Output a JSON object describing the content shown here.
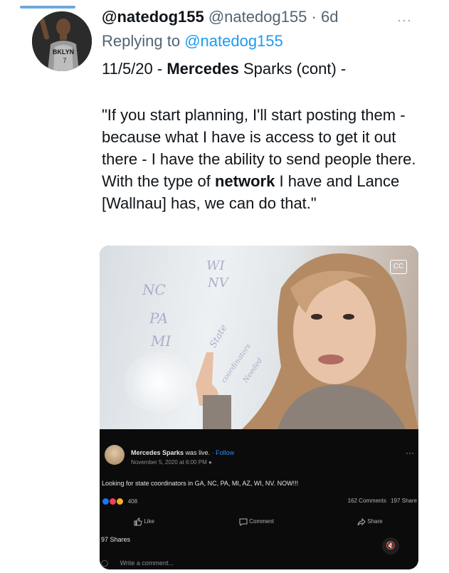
{
  "tweet": {
    "display_name": "@natedog155",
    "handle": "@natedog155",
    "separator": "·",
    "age": "6d",
    "more_icon": "ellipsis-icon",
    "replying_prefix": "Replying to",
    "replying_to": "@natedog155",
    "line_date": "11/5/20 -",
    "line_name_bold": "Mercedes",
    "line_rest": "Sparks (cont) -",
    "quote_part1": "\"If you start planning, I'll start posting them - because what I have is access to get it out there - I have the ability to send people there. With the type of",
    "quote_bold": "network",
    "quote_part2": "I have and Lance [Wallnau] has, we can do that.\""
  },
  "avatar": {
    "jersey_text": "BKLYN",
    "jersey_number": "7"
  },
  "video": {
    "board_texts": [
      "WI",
      "NV",
      "NC",
      "PA",
      "MI",
      "State",
      "coordinators",
      "Needed"
    ],
    "cc_label": "CC"
  },
  "facebook": {
    "poster_name": "Mercedes Sparks",
    "poster_action": "was live.",
    "follow_label": "Follow",
    "date": "November 5, 2020 at 6:00 PM",
    "post_text": "Looking for state coordinators in GA, NC, PA, MI, AZ, WI, NV. NOW!!!",
    "reaction_count": "408",
    "comments": "162 Comments",
    "shares_short": "197 Share",
    "like_label": "Like",
    "comment_label": "Comment",
    "share_label": "Share",
    "shares_line": "97 Shares",
    "write_comment": "Write a comment...",
    "reaction_colors": [
      "#1877f2",
      "#f33e58",
      "#f7b125"
    ]
  },
  "colors": {
    "link": "#1d9bf0",
    "muted": "#536471",
    "fb_link": "#2d88ff"
  }
}
